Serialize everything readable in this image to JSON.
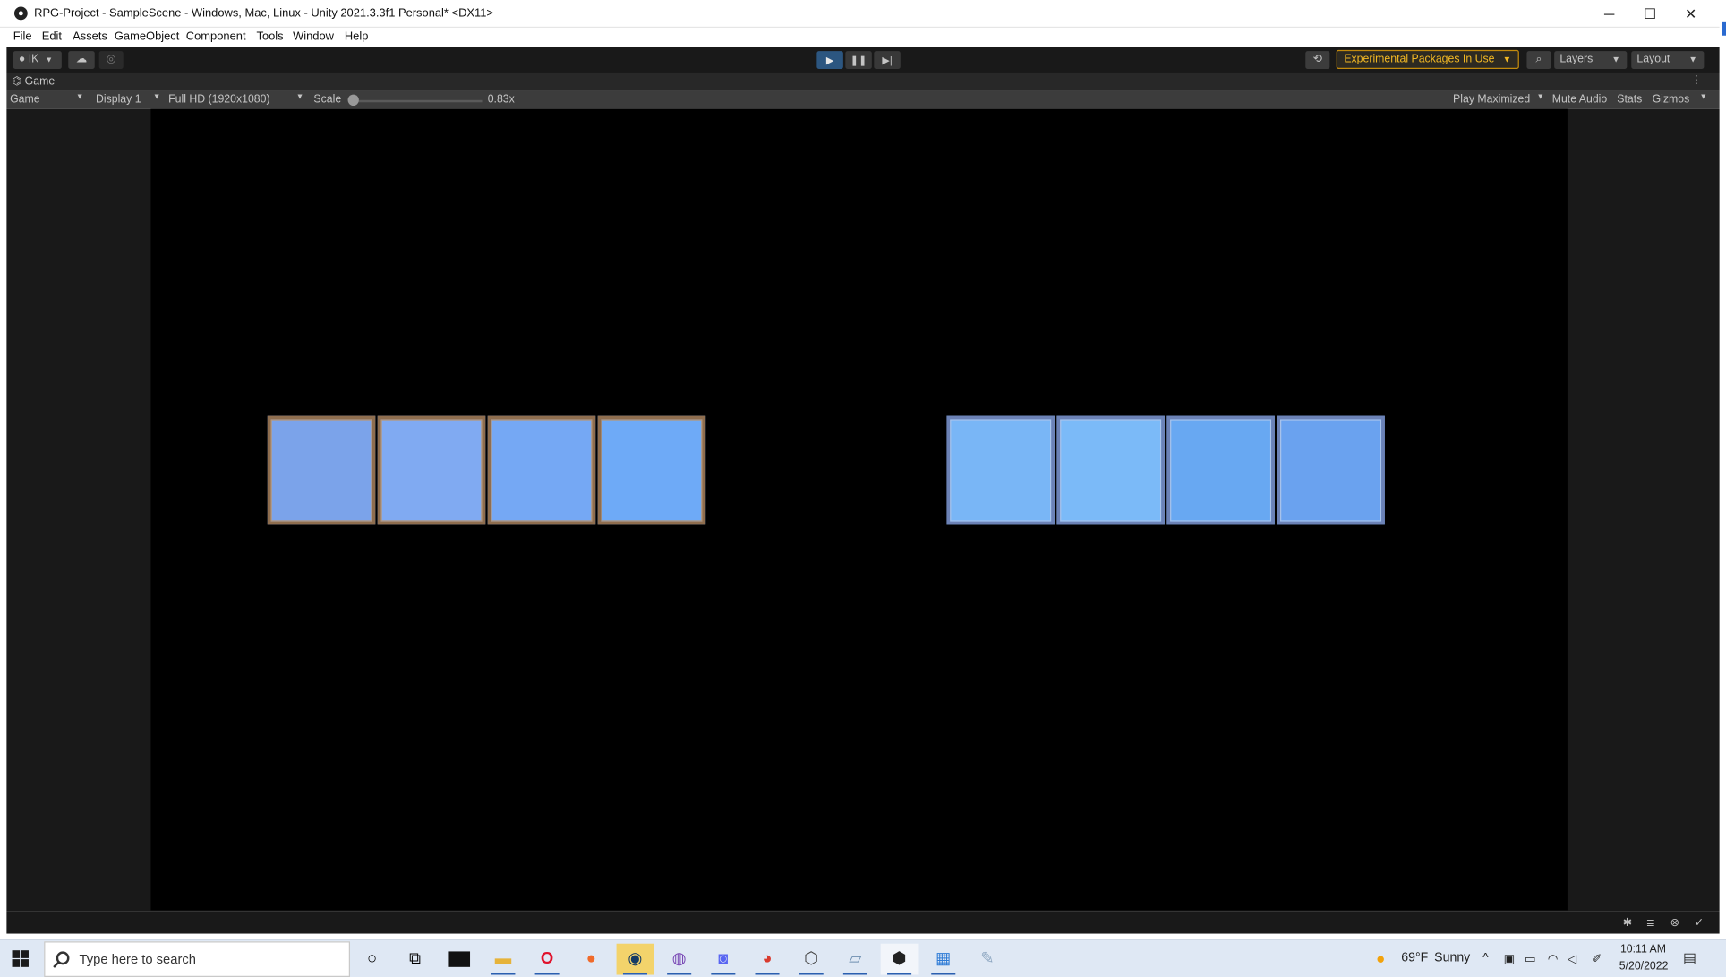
{
  "window": {
    "title": "RPG-Project - SampleScene - Windows, Mac, Linux - Unity 2021.3.3f1 Personal* <DX11>",
    "minimize": "─",
    "maximize": "☐",
    "close": "✕"
  },
  "menu": [
    "File",
    "Edit",
    "Assets",
    "GameObject",
    "Component",
    "Tools",
    "Window",
    "Help"
  ],
  "toolbar": {
    "account_label": "IK",
    "play_icon": "▶",
    "pause_icon": "❚❚",
    "step_icon": "▶|",
    "history_icon": "⟲",
    "experimental_label": "Experimental Packages In Use",
    "search_icon": "⌕",
    "layers_label": "Layers",
    "layout_label": "Layout",
    "play_active_color": "#2c5680"
  },
  "game_tab": {
    "label": "Game",
    "menu_icon": "⋮"
  },
  "game_toolbar": {
    "view_select": "Game",
    "display_select": "Display 1",
    "resolution_select": "Full HD (1920x1080)",
    "scale_label": "Scale",
    "scale_value": "0.83x",
    "play_mode": "Play Maximized",
    "mute_audio": "Mute Audio",
    "stats": "Stats",
    "gizmos": "Gizmos"
  },
  "game_view": {
    "left_slots": [
      "#7ba3ea",
      "#80aaf2",
      "#75a8f4",
      "#6eaaf7"
    ],
    "right_slots": [
      "#79b6f6",
      "#7bbaf8",
      "#68a8f2",
      "#6aa2ef"
    ]
  },
  "taskbar": {
    "search_placeholder": "Type here to search",
    "weather_temp": "69°F",
    "weather_text": "Sunny",
    "time": "10:11 AM",
    "date": "5/20/2022"
  }
}
